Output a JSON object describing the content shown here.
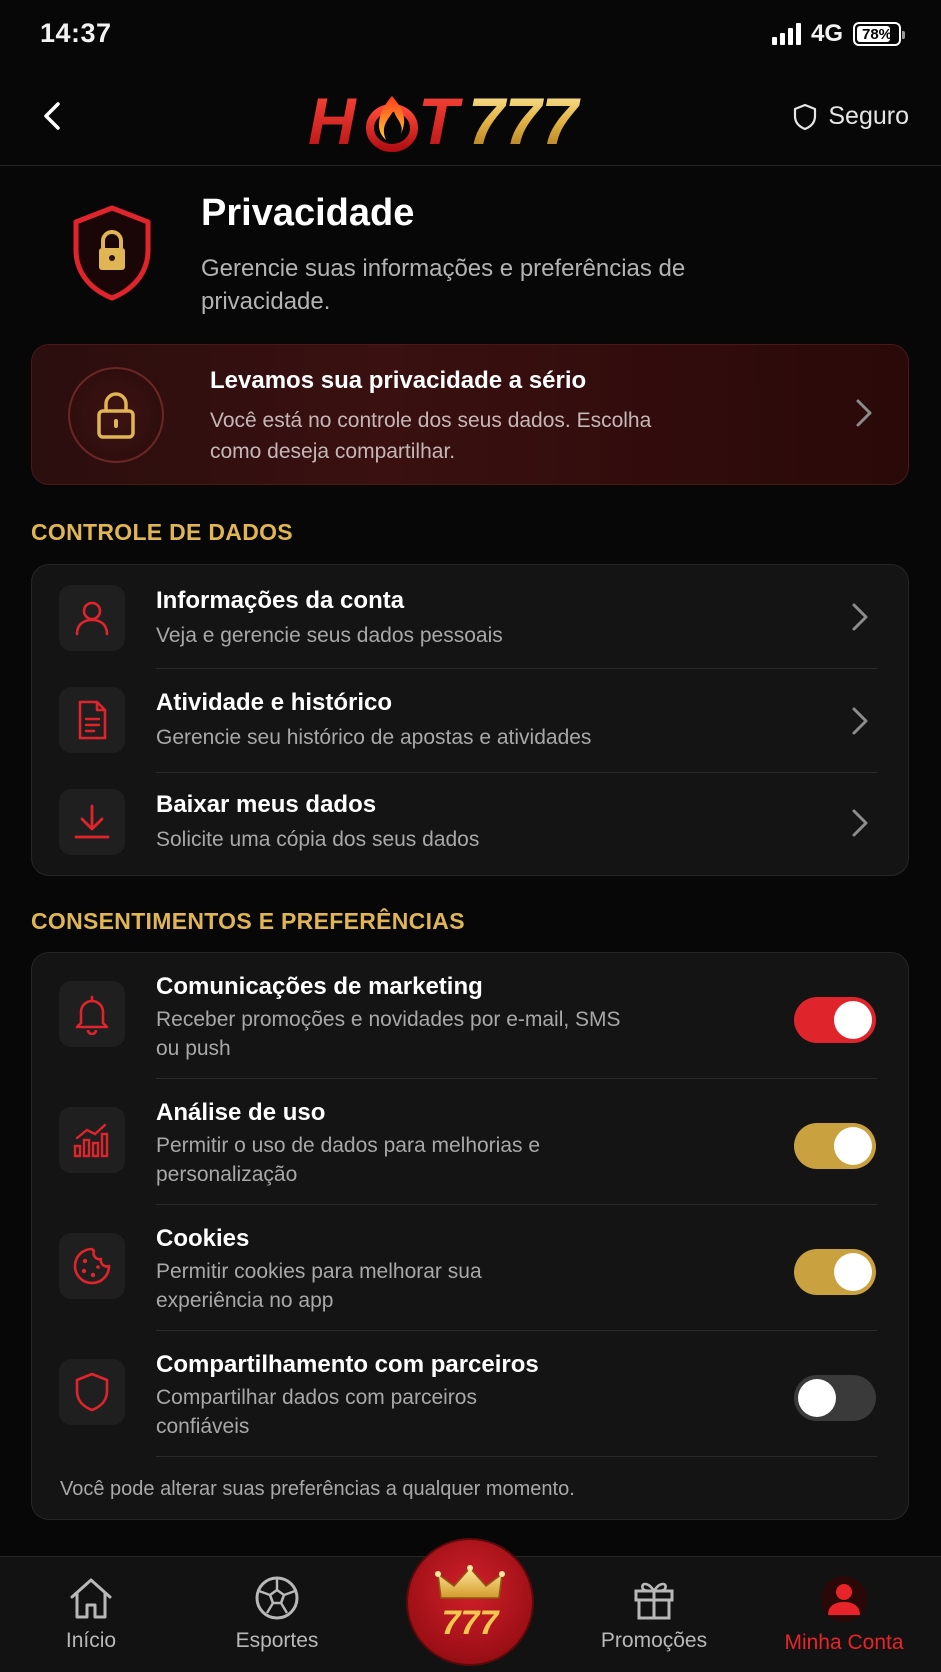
{
  "status_bar": {
    "time": "14:37",
    "network": "4G",
    "battery": "78%"
  },
  "header": {
    "logo_text": "HOT777",
    "secure_label": "Seguro"
  },
  "page": {
    "title": "Privacidade",
    "subtitle": "Gerencie suas informações e preferências de privacidade."
  },
  "banner": {
    "title": "Levamos sua privacidade a sério",
    "subtitle": "Você está no controle dos seus dados. Escolha como deseja compartilhar."
  },
  "data_control": {
    "section_title": "CONTROLE DE DADOS",
    "items": [
      {
        "title": "Informações da conta",
        "subtitle": "Veja e gerencie seus dados pessoais",
        "icon": "user-icon"
      },
      {
        "title": "Atividade e histórico",
        "subtitle": "Gerencie seu histórico de apostas e atividades",
        "icon": "document-icon"
      },
      {
        "title": "Baixar meus dados",
        "subtitle": "Solicite uma cópia dos seus dados",
        "icon": "download-icon"
      }
    ]
  },
  "consents": {
    "section_title": "CONSENTIMENTOS E PREFERÊNCIAS",
    "items": [
      {
        "title": "Comunicações de marketing",
        "subtitle": "Receber promoções e novidades por e-mail, SMS ou push",
        "icon": "bell-icon",
        "enabled": true,
        "color": "#e0242c"
      },
      {
        "title": "Análise de uso",
        "subtitle": "Permitir o uso de dados para melhorias e personalização",
        "icon": "chart-icon",
        "enabled": true,
        "color": "#c9a13f"
      },
      {
        "title": "Cookies",
        "subtitle": "Permitir cookies para melhorar sua experiência no app",
        "icon": "cookie-icon",
        "enabled": true,
        "color": "#c9a13f"
      },
      {
        "title": "Compartilhamento com parceiros",
        "subtitle": "Compartilhar dados com parceiros confiáveis",
        "icon": "shield-icon",
        "enabled": false,
        "color": "#3a3a3a"
      }
    ],
    "note": "Você pode alterar suas preferências a qualquer momento."
  },
  "bottom_nav": {
    "items": [
      {
        "label": "Início",
        "icon": "home-icon"
      },
      {
        "label": "Esportes",
        "icon": "soccer-ball-icon"
      },
      {
        "label": "777",
        "icon": "crown-icon"
      },
      {
        "label": "Promoções",
        "icon": "gift-icon"
      },
      {
        "label": "Minha Conta",
        "icon": "account-icon",
        "active": true
      }
    ]
  },
  "colors": {
    "accent_red": "#e0242c",
    "accent_gold": "#e0b554",
    "background": "#070707"
  }
}
